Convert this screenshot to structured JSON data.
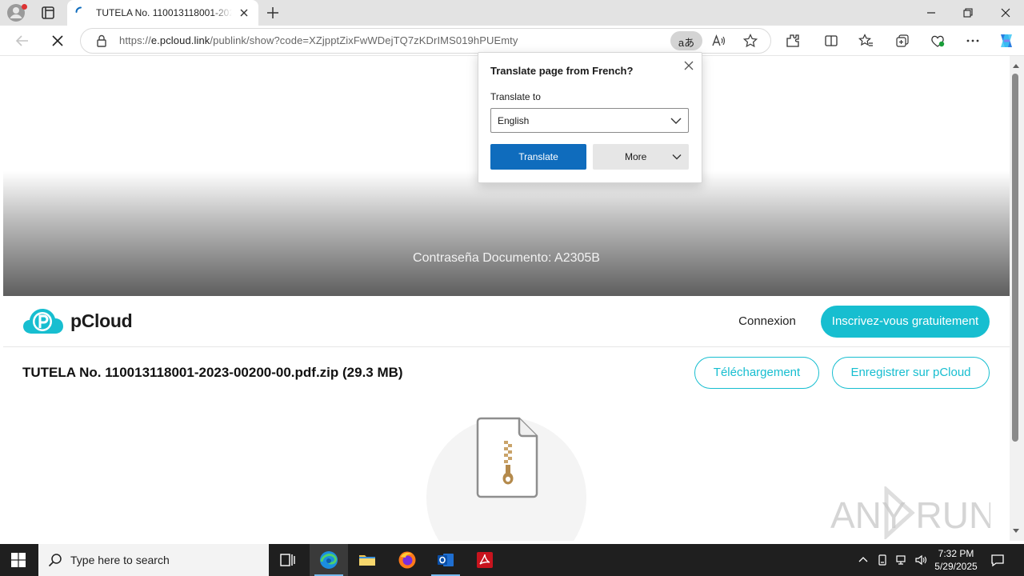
{
  "browser": {
    "tab_title": "TUTELA No. 110013118001-2023-00200-00.pdf.zip",
    "url_scheme": "https://",
    "url_host": "e.pcloud.link",
    "url_path": "/publink/show?code=XZjpptZixFwWDejTQ7zKDrIMS019hPUEmty",
    "translate_pill": "aあ"
  },
  "translate_popup": {
    "title": "Translate page from French?",
    "label": "Translate to",
    "selected_language": "English",
    "translate_button": "Translate",
    "more_button": "More"
  },
  "page": {
    "hero_text": "Contraseña Documento: A2305B",
    "logo_text": "pCloud",
    "login_link": "Connexion",
    "signup_button": "Inscrivez-vous gratuitement",
    "file_title": "TUTELA No. 110013118001-2023-00200-00.pdf.zip (29.3 MB)",
    "download_button": "Téléchargement",
    "save_button": "Enregistrer sur pCloud",
    "watermark_text": "ANY RUN"
  },
  "taskbar": {
    "search_placeholder": "Type here to search",
    "time": "7:32 PM",
    "date": "5/29/2025"
  },
  "colors": {
    "accent": "#17bed0",
    "translate_blue": "#0f6cbd"
  }
}
